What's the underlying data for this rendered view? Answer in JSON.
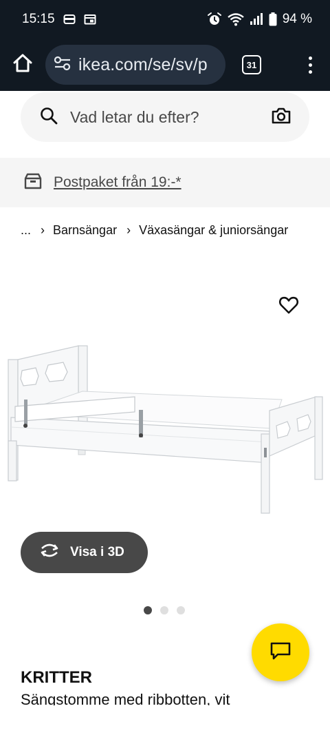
{
  "status_bar": {
    "time": "15:15",
    "battery": "94 %"
  },
  "browser": {
    "url": "ikea.com/se/sv/p",
    "tab_count": "31"
  },
  "search": {
    "placeholder": "Vad letar du efter?"
  },
  "promo": {
    "label": "Postpaket från 19:-*"
  },
  "breadcrumb": {
    "ellipsis": "...",
    "items": [
      "Barnsängar",
      "Växasängar & juniorsängar"
    ],
    "separator": "›"
  },
  "product": {
    "view3d_label": "Visa i 3D",
    "image_count": 3,
    "active_image_index": 0,
    "name": "KRITTER",
    "description": "Sängstomme med ribbotten, vit"
  },
  "icons": {
    "home": "home-icon",
    "site_settings": "tune-icon",
    "search": "search-icon",
    "camera": "camera-icon",
    "box": "parcel-icon",
    "favourite": "heart-icon",
    "rotate": "rotate-3d-icon",
    "chat": "chat-icon"
  },
  "colors": {
    "browser_bg": "#111922",
    "url_pill": "#263140",
    "chat_fab": "#ffdb00",
    "button_dark": "#484848",
    "surface_grey": "#f5f5f5"
  }
}
